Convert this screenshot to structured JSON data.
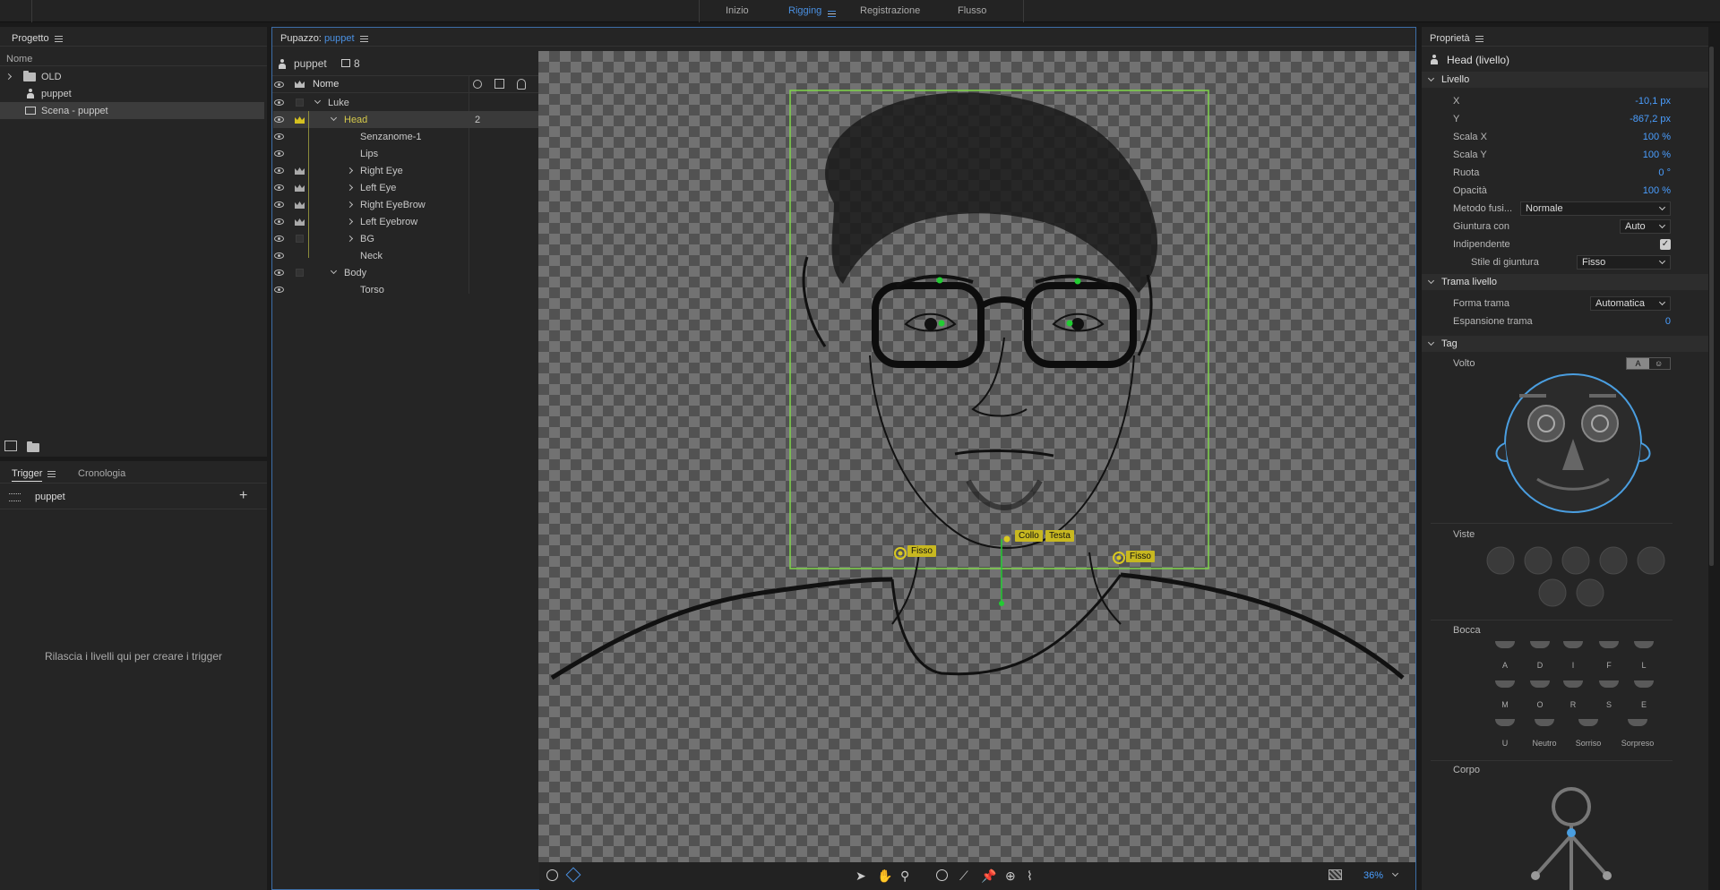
{
  "workspaces": {
    "tabs": [
      "Inizio",
      "Rigging",
      "Registrazione",
      "Flusso"
    ],
    "active": "Rigging"
  },
  "project_panel": {
    "title": "Progetto",
    "column_header": "Nome",
    "items": [
      {
        "name": "OLD",
        "type": "folder"
      },
      {
        "name": "puppet",
        "type": "puppet"
      },
      {
        "name": "Scena - puppet",
        "type": "scene",
        "selected": true
      }
    ]
  },
  "triggers_panel": {
    "tabs": [
      "Trigger",
      "Cronologia"
    ],
    "active_tab": "Trigger",
    "puppet_name": "puppet",
    "empty_message": "Rilascia i livelli qui per creare i trigger"
  },
  "puppet_panel": {
    "title_prefix": "Pupazzo:",
    "puppet_name": "puppet",
    "header_puppet": "puppet",
    "layer_count": "8",
    "column_header": "Nome",
    "layers": [
      {
        "name": "Luke",
        "depth": 0,
        "expand": "down",
        "crown": false,
        "count": ""
      },
      {
        "name": "Head",
        "depth": 1,
        "expand": "down",
        "crown": true,
        "count": "2",
        "selected": true
      },
      {
        "name": "Senzanome-1",
        "depth": 2,
        "expand": "",
        "crown": false,
        "count": ""
      },
      {
        "name": "Lips",
        "depth": 2,
        "expand": "",
        "crown": false,
        "count": ""
      },
      {
        "name": "Right Eye",
        "depth": 2,
        "expand": "right",
        "crown": true,
        "count": ""
      },
      {
        "name": "Left Eye",
        "depth": 2,
        "expand": "right",
        "crown": true,
        "count": ""
      },
      {
        "name": "Right EyeBrow",
        "depth": 2,
        "expand": "right",
        "crown": true,
        "count": ""
      },
      {
        "name": "Left Eyebrow",
        "depth": 2,
        "expand": "right",
        "crown": true,
        "count": ""
      },
      {
        "name": "BG",
        "depth": 2,
        "expand": "right",
        "crown": false,
        "count": ""
      },
      {
        "name": "Neck",
        "depth": 2,
        "expand": "",
        "crown": false,
        "count": ""
      },
      {
        "name": "Body",
        "depth": 1,
        "expand": "down",
        "crown": false,
        "count": ""
      },
      {
        "name": "Torso",
        "depth": 2,
        "expand": "",
        "crown": false,
        "count": ""
      }
    ]
  },
  "canvas": {
    "handles": [
      {
        "label": "Fisso"
      },
      {
        "label": "Collo"
      },
      {
        "label": "Testa"
      },
      {
        "label": "Fisso"
      }
    ],
    "zoom": "36%"
  },
  "properties_panel": {
    "title": "Proprietà",
    "selection": "Head (livello)",
    "sections": {
      "livello": "Livello",
      "trama": "Trama livello",
      "tag": "Tag"
    },
    "livello": [
      {
        "label": "X",
        "value": "-10,1 px"
      },
      {
        "label": "Y",
        "value": "-867,2 px"
      },
      {
        "label": "Scala X",
        "value": "100 %"
      },
      {
        "label": "Scala Y",
        "value": "100 %"
      },
      {
        "label": "Ruota",
        "value": "0 °"
      },
      {
        "label": "Opacità",
        "value": "100 %"
      }
    ],
    "blend_label": "Metodo fusi...",
    "blend_value": "Normale",
    "join_label": "Giuntura con",
    "join_value": "Auto",
    "independent_label": "Indipendente",
    "join_style_label": "Stile di giuntura",
    "join_style_value": "Fisso",
    "mesh_shape_label": "Forma trama",
    "mesh_shape_value": "Automatica",
    "mesh_expand_label": "Espansione trama",
    "mesh_expand_value": "0",
    "face_label": "Volto",
    "face_toggle": "A",
    "views_label": "Viste",
    "mouth_label": "Bocca",
    "mouths": [
      "A",
      "D",
      "I",
      "F",
      "L",
      "M",
      "O",
      "R",
      "S",
      "E",
      "U",
      "Neutro",
      "Sorriso",
      "Sorpreso"
    ],
    "body_label": "Corpo"
  },
  "colors": {
    "accent": "#4a90e2",
    "value_blue": "#4a9eff",
    "handle_yellow": "#c8b820",
    "bounds_green": "#7fd44a",
    "active_text": "#d4c84a"
  }
}
